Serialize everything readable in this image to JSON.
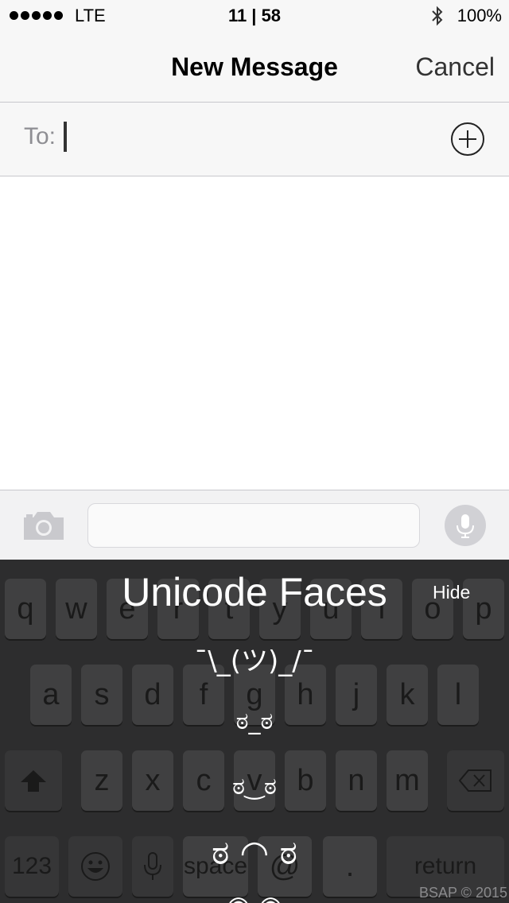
{
  "status_bar": {
    "signal_dots": 5,
    "carrier": "LTE",
    "time": "11 | 58",
    "bluetooth_icon": "bluetooth-icon",
    "battery": "100%"
  },
  "nav": {
    "title": "New Message",
    "cancel_label": "Cancel"
  },
  "to_field": {
    "label": "To:",
    "value": "",
    "add_icon": "plus-circle-icon"
  },
  "compose": {
    "camera_icon": "camera-icon",
    "message_value": "",
    "mic_icon": "microphone-icon"
  },
  "keyboard": {
    "row1": [
      "q",
      "w",
      "e",
      "r",
      "t",
      "y",
      "u",
      "i",
      "o",
      "p"
    ],
    "row2": [
      "a",
      "s",
      "d",
      "f",
      "g",
      "h",
      "j",
      "k",
      "l"
    ],
    "row3": [
      "z",
      "x",
      "c",
      "v",
      "b",
      "n",
      "m"
    ],
    "shift_icon": "shift-icon",
    "delete_icon": "delete-icon",
    "numbers_label": "123",
    "emoji_icon": "emoji-icon",
    "dictation_icon": "microphone-icon",
    "space_label": "space",
    "at_label": "@",
    "period_label": ".",
    "return_label": "return"
  },
  "overlay": {
    "title": "Unicode Faces",
    "hide_label": "Hide",
    "faces": [
      "¯\\_(ツ)_/¯",
      "ಠ_ಠ",
      "ಠ‿ಠ",
      "ಠ ◠ ಠ",
      "◉  ◉"
    ],
    "credit": "BSAP © 2015"
  },
  "colors": {
    "bar_bg": "#f7f7f7",
    "keyboard_bg": "#2d2d2e",
    "key_bg": "#404041",
    "overlay_text": "#ffffff"
  }
}
